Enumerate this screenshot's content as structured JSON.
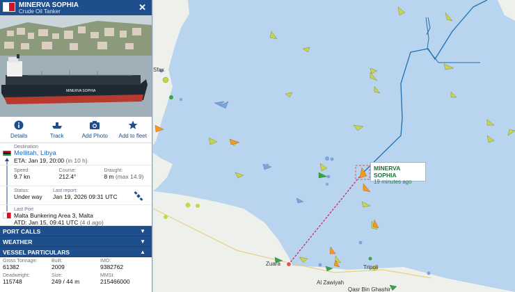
{
  "vessel": {
    "name": "MINERVA SOPHIA",
    "type": "Crude Oil Tanker",
    "hull_text": "MINERVA SOPHIA"
  },
  "actions": [
    {
      "label": "Details",
      "icon": "info-icon"
    },
    {
      "label": "Track",
      "icon": "ship-icon"
    },
    {
      "label": "Add Photo",
      "icon": "camera-icon"
    },
    {
      "label": "Add to fleet",
      "icon": "star-icon"
    }
  ],
  "destination": {
    "label": "Destination",
    "port": "Mellitah, Libya",
    "eta_label": "ETA:",
    "eta": "Jan 19, 20:00",
    "eta_rel": "(in 10 h)"
  },
  "status": {
    "speed_label": "Speed:",
    "speed": "9.7 kn",
    "course_label": "Course:",
    "course": "212.4°",
    "draught_label": "Draught:",
    "draught": "8 m",
    "draught_max": "(max 14.9)",
    "status_label": "Status:",
    "status": "Under way",
    "report_label": "Last report:",
    "report": "Jan 19, 2026 09:31 UTC"
  },
  "last_port": {
    "label": "Last Port",
    "port": "Malta Bunkering Area 3, Malta",
    "atd_label": "ATD:",
    "atd": "Jan 15, 09:41 UTC",
    "atd_rel": "(4 d ago)"
  },
  "bars": {
    "port_calls": "PORT CALLS",
    "weather": "WEATHER",
    "particulars": "VESSEL PARTICULARS"
  },
  "particulars": {
    "gt_label": "Gross Tonnage:",
    "gt": "61382",
    "built_label": "Built:",
    "built": "2009",
    "imo_label": "IMO:",
    "imo": "9382762",
    "dwt_label": "Deadweight:",
    "dwt": "115748",
    "size_label": "Size:",
    "size": "249 / 44 m",
    "mmsi_label": "MMSI:",
    "mmsi": "215466000"
  },
  "map_label": {
    "name": "MINERVA SOPHIA",
    "age": "19 minutes ago"
  },
  "places": {
    "zuara": "Zuara",
    "tripoli": "Tripoli",
    "zawiyah": "Al Zawiyah",
    "qasr": "Qasr Bin Ghashir",
    "sfax": "Sfax"
  },
  "colors": {
    "header": "#1f4e8c",
    "sea": "#b9d4ee",
    "land": "#eef0ec",
    "track": "#1f6fb0",
    "route": "#d0246a"
  }
}
